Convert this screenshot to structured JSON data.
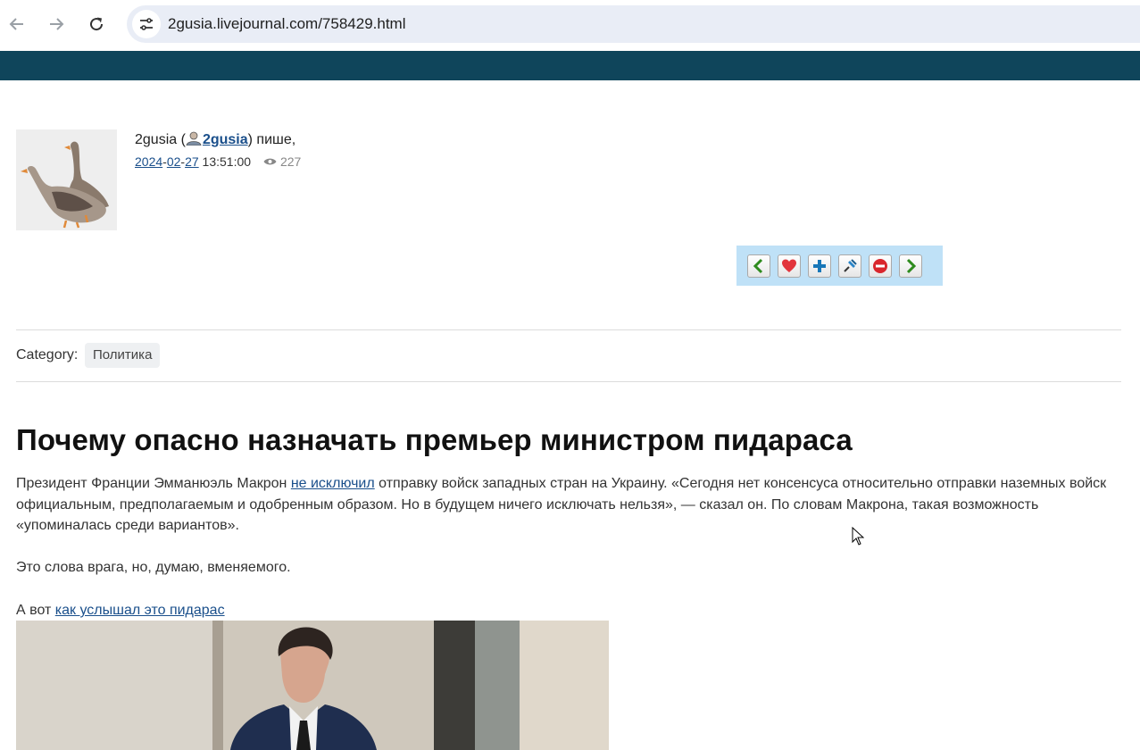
{
  "browser": {
    "url": "2gusia.livejournal.com/758429.html"
  },
  "post": {
    "author_display": "2gusia",
    "byline_open": " (",
    "author_link": "2gusia",
    "byline_close": ") пише,",
    "date_year": "2024",
    "date_month": "02",
    "date_day": "27",
    "time": "13:51:00",
    "views": "227",
    "category_label": "Category:",
    "category_tag": "Политика",
    "title": "Почему опасно назначать премьер министром пидараса",
    "p1_before": "Президент Франции Эмманюэль Макрон ",
    "p1_link": "не исключил",
    "p1_after": " отправку войск западных стран на Украину. «Сегодня нет консенсуса относительно отправки наземных войск официальным, предполагаемым и одобренным образом. Но в будущем ничего исключать нельзя», — сказал он. По словам Макрона, такая возможность «упоминалась среди вариантов».",
    "p2": "Это слова врага, но, думаю, вменяемого.",
    "p3_before": "А вот ",
    "p3_link": "как услышал это пидарас"
  },
  "colors": {
    "lj_bar": "#0f455b",
    "link": "#1a4f8b",
    "action_bar": "#bfe1f7"
  },
  "icons": {
    "back": "arrow-left-icon",
    "forward": "arrow-right-icon",
    "reload": "reload-icon",
    "site_info": "tune-icon",
    "views": "eye-icon",
    "actions": [
      "prev-arrow-icon",
      "heart-icon",
      "plus-icon",
      "pin-icon",
      "stop-icon",
      "next-arrow-icon"
    ]
  }
}
